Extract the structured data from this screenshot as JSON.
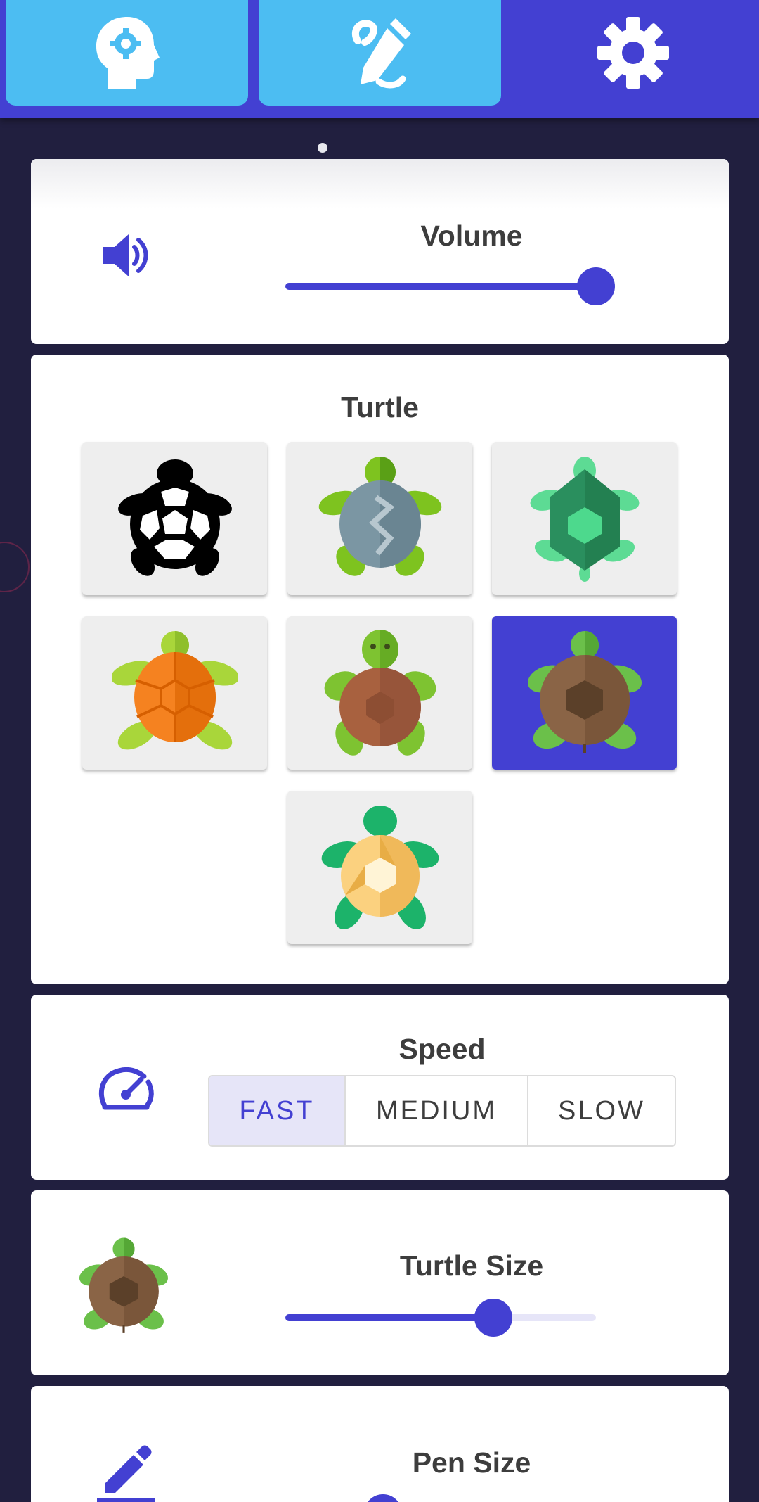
{
  "tabs": [
    {
      "name": "mind-gear",
      "icon": "head-gear-icon"
    },
    {
      "name": "draw",
      "icon": "pencil-draw-icon"
    },
    {
      "name": "settings",
      "icon": "gear-icon",
      "selected": true
    }
  ],
  "colors": {
    "accent": "#4340d2",
    "tab": "#4cbdf2",
    "background": "#211f3f"
  },
  "volume": {
    "title": "Volume",
    "icon": "volume-icon",
    "value": 1.0
  },
  "turtle": {
    "title": "Turtle",
    "options": [
      {
        "id": "black-silhouette",
        "selected": false
      },
      {
        "id": "gray-shell",
        "selected": false
      },
      {
        "id": "green-shell",
        "selected": false
      },
      {
        "id": "orange-shell",
        "selected": false
      },
      {
        "id": "brown-light",
        "selected": false
      },
      {
        "id": "brown-dark",
        "selected": true
      },
      {
        "id": "yellow-shell",
        "selected": false
      }
    ]
  },
  "speed": {
    "title": "Speed",
    "icon": "speedometer-icon",
    "options": [
      "FAST",
      "MEDIUM",
      "SLOW"
    ],
    "selected": "FAST"
  },
  "turtle_size": {
    "title": "Turtle Size",
    "value": 0.67
  },
  "pen_size": {
    "title": "Pen Size",
    "icon": "pen-icon"
  }
}
